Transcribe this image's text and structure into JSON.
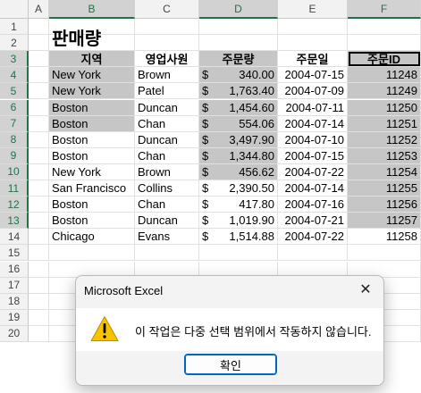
{
  "columns": [
    "A",
    "B",
    "C",
    "D",
    "E",
    "F"
  ],
  "selected_columns": [
    "B",
    "D",
    "F"
  ],
  "rows": [
    "1",
    "2",
    "3",
    "4",
    "5",
    "6",
    "7",
    "8",
    "9",
    "10",
    "11",
    "12",
    "13",
    "14",
    "15",
    "16",
    "17",
    "18",
    "19",
    "20"
  ],
  "selected_rows": [
    "3",
    "4",
    "5",
    "6",
    "7",
    "8",
    "9",
    "10",
    "11",
    "12",
    "13"
  ],
  "title": "판매량",
  "headers": {
    "region": "지역",
    "rep": "영업사원",
    "amount": "주문량",
    "date": "주문일",
    "id": "주문ID"
  },
  "table": [
    {
      "region": "New York",
      "rep": "Brown",
      "cur": "$",
      "amount": "340.00",
      "date": "2004-07-15",
      "id": "11248"
    },
    {
      "region": "New York",
      "rep": "Patel",
      "cur": "$",
      "amount": "1,763.40",
      "date": "2004-07-09",
      "id": "11249"
    },
    {
      "region": "Boston",
      "rep": "Duncan",
      "cur": "$",
      "amount": "1,454.60",
      "date": "2004-07-11",
      "id": "11250"
    },
    {
      "region": "Boston",
      "rep": "Chan",
      "cur": "$",
      "amount": "554.06",
      "date": "2004-07-14",
      "id": "11251"
    },
    {
      "region": "Boston",
      "rep": "Duncan",
      "cur": "$",
      "amount": "3,497.90",
      "date": "2004-07-10",
      "id": "11252"
    },
    {
      "region": "Boston",
      "rep": "Chan",
      "cur": "$",
      "amount": "1,344.80",
      "date": "2004-07-15",
      "id": "11253"
    },
    {
      "region": "New York",
      "rep": "Brown",
      "cur": "$",
      "amount": "456.62",
      "date": "2004-07-22",
      "id": "11254"
    },
    {
      "region": "San Francisco",
      "rep": "Collins",
      "cur": "$",
      "amount": "2,390.50",
      "date": "2004-07-14",
      "id": "11255"
    },
    {
      "region": "Boston",
      "rep": "Chan",
      "cur": "$",
      "amount": "417.80",
      "date": "2004-07-16",
      "id": "11256"
    },
    {
      "region": "Boston",
      "rep": "Duncan",
      "cur": "$",
      "amount": "1,019.90",
      "date": "2004-07-21",
      "id": "11257"
    },
    {
      "region": "Chicago",
      "rep": "Evans",
      "cur": "$",
      "amount": "1,514.88",
      "date": "2004-07-22",
      "id": "11258"
    }
  ],
  "dialog": {
    "title": "Microsoft Excel",
    "close_icon": "close-icon",
    "icon": "warning-icon",
    "message": "이 작업은 다중 선택 범위에서 작동하지 않습니다.",
    "ok_label": "확인"
  },
  "colors": {
    "accent": "#217346",
    "selection": "#c6c6c6",
    "warning": "#f8c200"
  }
}
